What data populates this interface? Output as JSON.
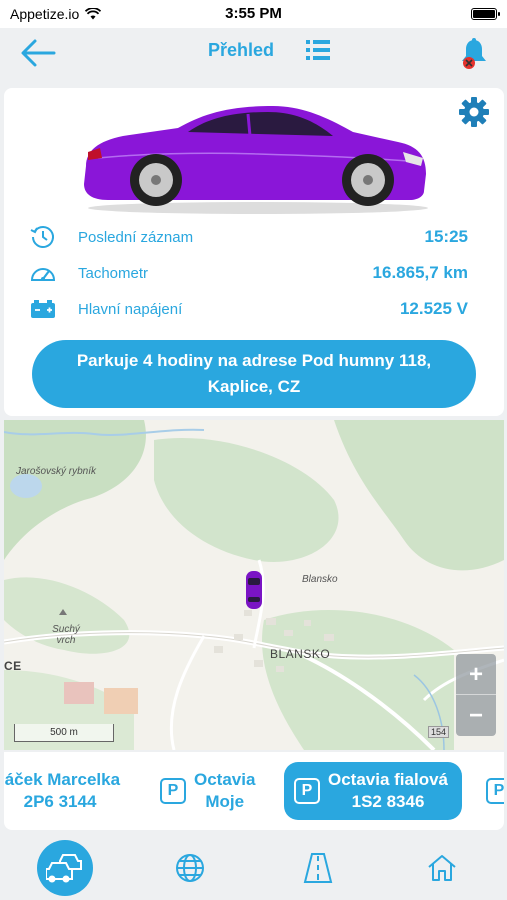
{
  "status_bar": {
    "carrier": "Appetize.io",
    "time": "3:55 PM"
  },
  "nav": {
    "title": "Přehled"
  },
  "vehicle_info": {
    "car_color": "#8a16d8",
    "rows": [
      {
        "icon": "clock-history-icon",
        "label": "Poslední záznam",
        "value": "15:25"
      },
      {
        "icon": "speedometer-icon",
        "label": "Tachometr",
        "value": "16.865,7 km"
      },
      {
        "icon": "battery-icon",
        "label": "Hlavní napájení",
        "value": "12.525 V"
      }
    ],
    "parking_status": "Parkuje 4 hodiny na adrese Pod humny 118, Kaplice, CZ"
  },
  "map": {
    "labels": {
      "pond": "Jarošovský rybník",
      "hill": "Suchý vrch",
      "village": "Blansko",
      "town": "BLANSKO",
      "edge": "CE"
    },
    "scale": "500 m",
    "road_number": "154",
    "zoom_in": "+",
    "zoom_out": "−"
  },
  "vehicles": [
    {
      "name": "láček Marcelka",
      "plate": "2P6 3144",
      "parked": false,
      "active": false
    },
    {
      "name": "Octavia",
      "plate": "Moje",
      "parked": true,
      "active": false
    },
    {
      "name": "Octavia fialová",
      "plate": "1S2 8346",
      "parked": true,
      "active": true
    }
  ],
  "parking_symbol": "P",
  "tabs": [
    {
      "icon": "cars-icon",
      "active": true
    },
    {
      "icon": "globe-icon",
      "active": false
    },
    {
      "icon": "road-icon",
      "active": false
    },
    {
      "icon": "home-icon",
      "active": false
    }
  ],
  "accent_color": "#2aa7df"
}
